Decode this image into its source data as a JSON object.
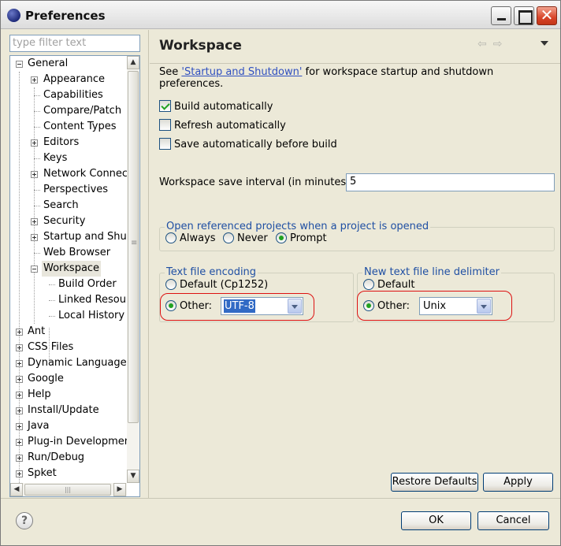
{
  "window": {
    "title": "Preferences",
    "close_glyph": "✕"
  },
  "filter": {
    "placeholder": "type filter text"
  },
  "tree": {
    "nodes": [
      {
        "label": "General",
        "level": 0,
        "expander": "minus"
      },
      {
        "label": "Appearance",
        "level": 1,
        "expander": "plus"
      },
      {
        "label": "Capabilities",
        "level": 1,
        "expander": "none"
      },
      {
        "label": "Compare/Patch",
        "level": 1,
        "expander": "none"
      },
      {
        "label": "Content Types",
        "level": 1,
        "expander": "none"
      },
      {
        "label": "Editors",
        "level": 1,
        "expander": "plus"
      },
      {
        "label": "Keys",
        "level": 1,
        "expander": "none"
      },
      {
        "label": "Network Connections",
        "level": 1,
        "expander": "plus"
      },
      {
        "label": "Perspectives",
        "level": 1,
        "expander": "none"
      },
      {
        "label": "Search",
        "level": 1,
        "expander": "none"
      },
      {
        "label": "Security",
        "level": 1,
        "expander": "plus"
      },
      {
        "label": "Startup and Shutdown",
        "level": 1,
        "expander": "plus"
      },
      {
        "label": "Web Browser",
        "level": 1,
        "expander": "none"
      },
      {
        "label": "Workspace",
        "level": 1,
        "expander": "minus",
        "selected": true
      },
      {
        "label": "Build Order",
        "level": 2,
        "expander": "none"
      },
      {
        "label": "Linked Resources",
        "level": 2,
        "expander": "none"
      },
      {
        "label": "Local History",
        "level": 2,
        "expander": "none"
      },
      {
        "label": "Ant",
        "level": 0,
        "expander": "plus"
      },
      {
        "label": "CSS Files",
        "level": 0,
        "expander": "plus"
      },
      {
        "label": "Dynamic Languages",
        "level": 0,
        "expander": "plus"
      },
      {
        "label": "Google",
        "level": 0,
        "expander": "plus"
      },
      {
        "label": "Help",
        "level": 0,
        "expander": "plus"
      },
      {
        "label": "Install/Update",
        "level": 0,
        "expander": "plus"
      },
      {
        "label": "Java",
        "level": 0,
        "expander": "plus"
      },
      {
        "label": "Plug-in Development",
        "level": 0,
        "expander": "plus"
      },
      {
        "label": "Run/Debug",
        "level": 0,
        "expander": "plus"
      },
      {
        "label": "Spket",
        "level": 0,
        "expander": "plus"
      }
    ]
  },
  "scroll": {
    "up": "▲",
    "down": "▼",
    "left": "◀",
    "right": "▶",
    "grip": "|||"
  },
  "page": {
    "title": "Workspace",
    "nav_back": "⇦",
    "nav_forward": "⇨",
    "intro_prefix": "See ",
    "intro_link": "'Startup and Shutdown'",
    "intro_suffix": " for workspace startup and shutdown preferences.",
    "checks": [
      {
        "label": "Build automatically",
        "checked": true
      },
      {
        "label": "Refresh automatically",
        "checked": false
      },
      {
        "label": "Save automatically before build",
        "checked": false
      }
    ],
    "interval_label": "Workspace save interval (in minutes):",
    "interval_value": "5",
    "open_group": {
      "title": "Open referenced projects when a project is opened",
      "options": [
        "Always",
        "Never",
        "Prompt"
      ],
      "selected": "Prompt"
    },
    "encoding_group": {
      "title": "Text file encoding",
      "default_label": "Default (Cp1252)",
      "other_label": "Other:",
      "other_value": "UTF-8",
      "selected": "Other"
    },
    "delimiter_group": {
      "title": "New text file line delimiter",
      "default_label": "Default",
      "other_label": "Other:",
      "other_value": "Unix",
      "selected": "Other"
    },
    "restore_defaults": "Restore Defaults",
    "apply": "Apply"
  },
  "footer": {
    "help": "?",
    "ok": "OK",
    "cancel": "Cancel"
  }
}
